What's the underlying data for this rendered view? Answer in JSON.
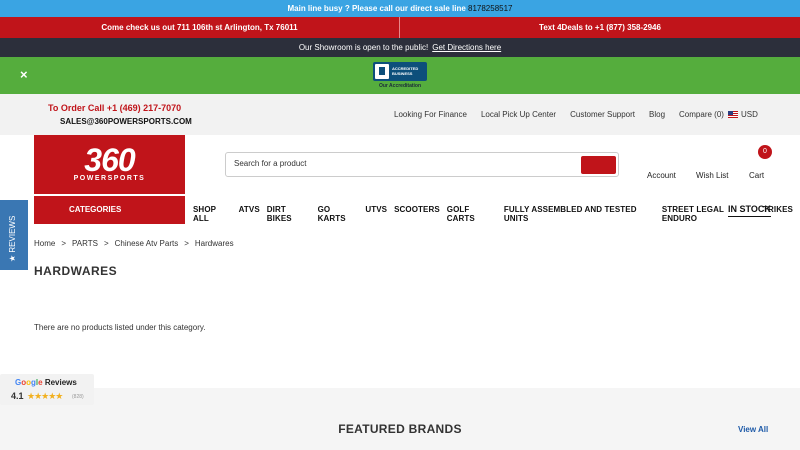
{
  "topbar": {
    "text": "Main line busy ? Please call our direct sale line ",
    "phone": "8178258517"
  },
  "promo": {
    "left": "Come check us out 711 106th st Arlington, Tx 76011",
    "right": "Text 4Deals to +1 (877) 358-2946"
  },
  "showroom": {
    "text": "Our Showroom is open to the public!",
    "link": "Get Directions here"
  },
  "bbb": {
    "badge_line1": "ACCREDITED",
    "badge_line2": "BUSINESS",
    "caption": "Our Accreditation",
    "close": "×"
  },
  "contact": {
    "order": "To Order Call +1 (469) 217-7070",
    "email": "SALES@360POWERSPORTS.COM"
  },
  "toplinks": [
    "Looking For Finance",
    "Local Pick Up Center",
    "Customer Support",
    "Blog",
    "Compare (0)"
  ],
  "currency": "USD",
  "logo": {
    "big": "360",
    "small": "POWERSPORTS"
  },
  "search": {
    "placeholder": "Search for a product"
  },
  "account": {
    "account": "Account",
    "wishlist": "Wish List",
    "cart": "Cart",
    "cart_count": "0"
  },
  "categories_label": "CATEGORIES",
  "nav": [
    "SHOP ALL",
    "ATVS",
    "DIRT BIKES",
    "GO KARTS",
    "UTVS",
    "SCOOTERS",
    "GOLF CARTS",
    "FULLY ASSEMBLED AND TESTED UNITS",
    "STREET LEGAL ENDURO",
    "TRIKES"
  ],
  "instock": "IN STOCK",
  "reviews_tab": "★ REVIEWS",
  "breadcrumb": [
    "Home",
    "PARTS",
    "Chinese Atv Parts",
    "Hardwares"
  ],
  "page_title": "HARDWARES",
  "empty_message": "There are no products listed under this category.",
  "google_reviews": {
    "label": "Reviews",
    "rating": "4.1",
    "stars": "★★★★★",
    "count": "(828)"
  },
  "featured": {
    "title": "FEATURED BRANDS",
    "view_all": "View All"
  }
}
